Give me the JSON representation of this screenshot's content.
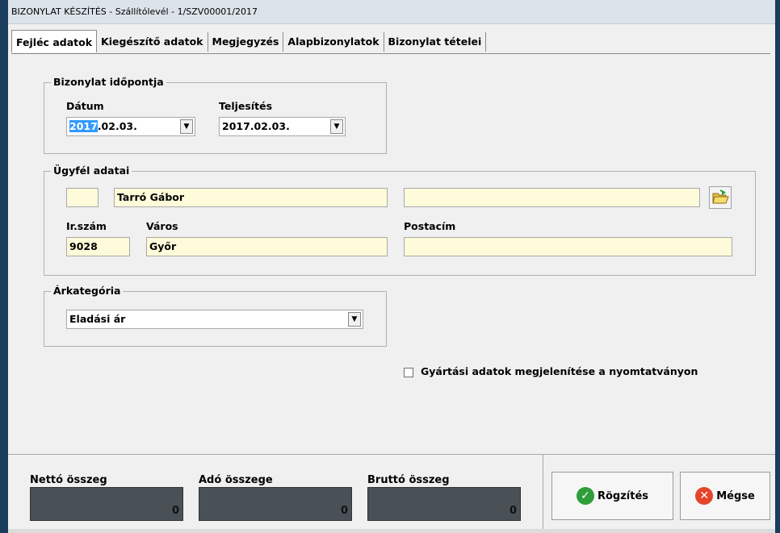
{
  "window": {
    "title": "BIZONYLAT KÉSZÍTÉS - Szállítólevél - 1/SZV00001/2017"
  },
  "tabs": [
    {
      "label": "Fejléc adatok",
      "active": true
    },
    {
      "label": "Kiegészítő adatok",
      "active": false
    },
    {
      "label": "Megjegyzés",
      "active": false
    },
    {
      "label": "Alapbizonylatok",
      "active": false
    },
    {
      "label": "Bizonylat tételei",
      "active": false
    }
  ],
  "doc_time": {
    "group_label": "Bizonylat időpontja",
    "date_label": "Dátum",
    "date_selected": "2017",
    "date_rest": ".02.03.",
    "fulfill_label": "Teljesítés",
    "fulfill_value": "2017.02.03."
  },
  "customer": {
    "group_label": "Ügyfél adatai",
    "code": "",
    "name": "Tarró Gábor",
    "extra": "",
    "zip_label": "Ir.szám",
    "zip": "9028",
    "city_label": "Város",
    "city": "Győr",
    "postal_label": "Postacím",
    "postal": ""
  },
  "price_category": {
    "group_label": "Árkategória",
    "value": "Eladási ár"
  },
  "options": {
    "show_production_label": "Gyártási adatok megjelenítése a nyomtatványon",
    "show_production_checked": false
  },
  "totals": {
    "net_label": "Nettó összeg",
    "net_value": "0",
    "tax_label": "Adó összege",
    "tax_value": "0",
    "gross_label": "Bruttó összeg",
    "gross_value": "0"
  },
  "actions": {
    "save_label": "Rögzítés",
    "cancel_label": "Mégse"
  },
  "colors": {
    "field_bg": "#fdfbd9",
    "sum_bg": "#4a5156",
    "save_icon": "#2e9e3a",
    "cancel_icon": "#e2452a"
  },
  "icons": {
    "browse": "folder-open-icon",
    "save": "check-circle-icon",
    "cancel": "x-circle-icon"
  }
}
